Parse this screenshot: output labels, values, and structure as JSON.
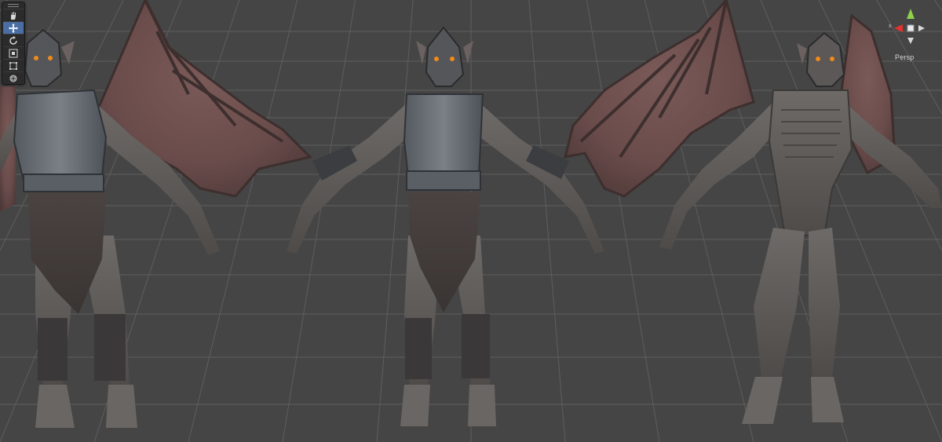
{
  "scene": {
    "background_color": "#454545",
    "grid_color": "#5e5e5e",
    "models": [
      {
        "name": "armored-winged-vampire-left"
      },
      {
        "name": "armored-winged-vampire-center"
      },
      {
        "name": "nude-winged-vampire-right"
      }
    ]
  },
  "toolbar": {
    "tools": [
      {
        "name": "hand-tool",
        "icon": "hand-icon",
        "active": false
      },
      {
        "name": "move-tool",
        "icon": "move-arrows-icon",
        "active": true
      },
      {
        "name": "rotate-tool",
        "icon": "rotate-icon",
        "active": false
      },
      {
        "name": "scale-tool",
        "icon": "scale-icon",
        "active": false
      },
      {
        "name": "rect-tool",
        "icon": "rect-icon",
        "active": false
      },
      {
        "name": "transform-tool",
        "icon": "transform-icon",
        "active": false
      }
    ],
    "accent_color": "#4a6ea3"
  },
  "gizmo": {
    "projection_label": "Persp",
    "x_axis_letter": "x",
    "colors": {
      "x": "#e0332b",
      "y": "#8fd14a",
      "z": "#3f7bd6"
    }
  }
}
